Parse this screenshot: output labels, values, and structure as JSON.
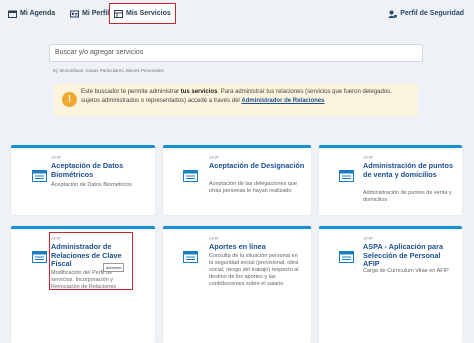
{
  "nav": {
    "agenda": "Mi Agenda",
    "perfil": "Mi Perfil",
    "servicios": "Mis Servicios",
    "seguridad": "Perfil de Seguridad"
  },
  "search": {
    "placeholder": "Buscar y/o agregar servicios",
    "hint": "Ej: Monotributo, Casas Particulares, Bienes Personales."
  },
  "alert": {
    "text_1": "Este buscador te permite administrar ",
    "text_bold": "tus servicios",
    "text_2": ". Para administrar tus relaciones (servicios que fueron delegados, sujetos administrados o representados) accedé a través del ",
    "link": "Administrador de Relaciones"
  },
  "cards": [
    {
      "tag": "AFIP",
      "title": "Aceptación de Datos Biométricos",
      "desc": "Aceptación de Datos Biometricos"
    },
    {
      "tag": "AFIP",
      "title": "Aceptación de Designación",
      "desc": "Aceptación de las delegaciones que otras personas le hayan realizado"
    },
    {
      "tag": "AFIP",
      "title": "Administración de puntos de venta y domicilios",
      "desc": "Administración de puntos de venta y domicilios"
    },
    {
      "tag": "AFIP",
      "title": "Administrador de Relaciones de Clave Fiscal",
      "desc": "Modificación del Perfil de servicios. Incorporación y Revocación de Relaciones"
    },
    {
      "tag": "AFIP",
      "title": "Aportes en línea",
      "desc": "Consulta de la situación personal en la seguridad social (previsional, obra social, riesgo del trabajo) respecto al destino de los aportes y las contribuciones sobre el salario"
    },
    {
      "tag": "AFIP",
      "title": "ASPA - Aplicación para Selección de Personal AFIP",
      "desc": "Carga de Curriculum Vitae en AFIP"
    }
  ],
  "tooltip": "adminrel",
  "colors": {
    "accent": "#1a8fd6",
    "title": "#1d4f91",
    "highlight": "#c0282d",
    "alert_bg": "#fdf4de"
  }
}
